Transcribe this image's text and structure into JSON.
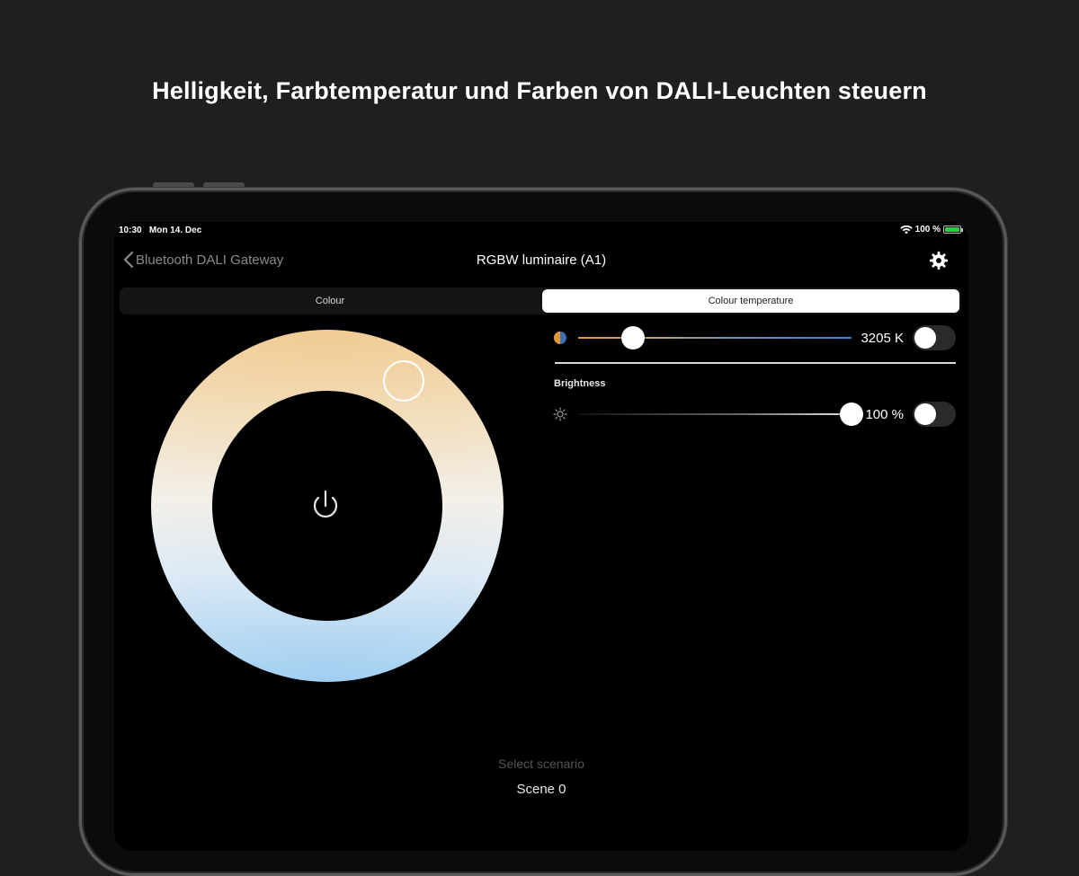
{
  "headline": "Helligkeit, Farbtemperatur und Farben von DALI-Leuchten steuern",
  "status_bar": {
    "time": "10:30",
    "date": "Mon 14. Dec",
    "battery": "100 %",
    "battery_color": "#2ecc40"
  },
  "nav": {
    "back_label": "Bluetooth DALI Gateway",
    "title": "RGBW luminaire (A1)",
    "settings_icon": "gear-icon"
  },
  "tabs": [
    {
      "label": "Colour",
      "selected": false
    },
    {
      "label": "Colour temperature",
      "selected": true
    }
  ],
  "colour_temperature": {
    "value_label": "3205 K",
    "slider_fraction": 0.2,
    "toggle_on": false
  },
  "brightness": {
    "label": "Brightness",
    "value_label": "100 %",
    "slider_fraction": 1.0,
    "toggle_on": false
  },
  "scenario": {
    "label": "Select scenario",
    "value": "Scene 0"
  },
  "colors": {
    "warm": "#f0c98e",
    "cool": "#9cccf0",
    "background": "#1f1f1f"
  }
}
